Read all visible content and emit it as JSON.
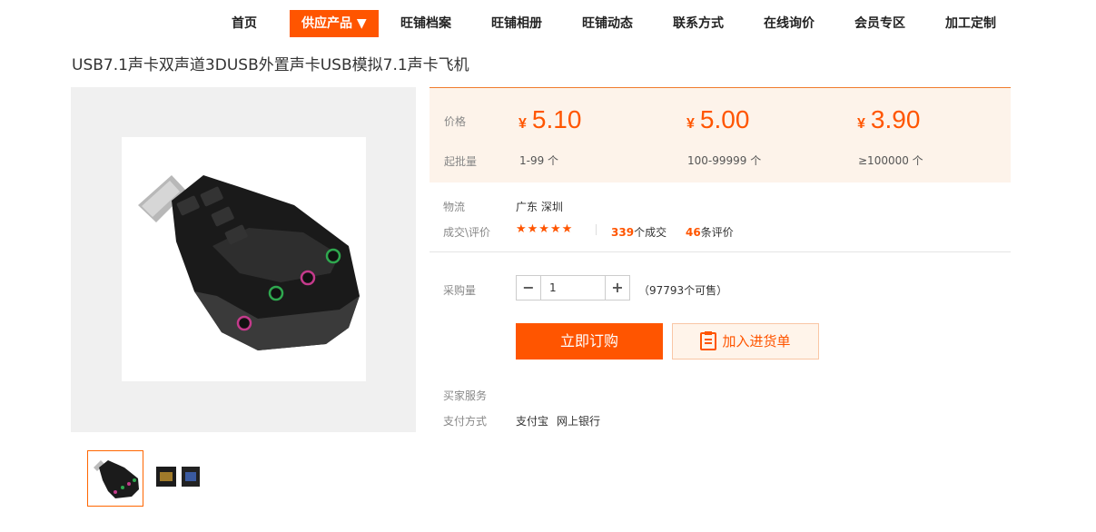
{
  "nav": {
    "items": [
      "首页",
      "供应产品 ▼",
      "旺铺档案",
      "旺铺相册",
      "旺铺动态",
      "联系方式",
      "在线询价",
      "会员专区",
      "加工定制"
    ]
  },
  "product": {
    "title": "USB7.1声卡双声道3DUSB外置声卡USB模拟7.1声卡飞机"
  },
  "price": {
    "price_label": "价格",
    "moq_label": "起批量",
    "currency": "¥",
    "tiers": [
      {
        "price": "5.10",
        "qty": "1-99 个"
      },
      {
        "price": "5.00",
        "qty": "100-99999 个"
      },
      {
        "price": "3.90",
        "qty": "≥100000 个"
      }
    ]
  },
  "logistics": {
    "label": "物流",
    "value": "广东 深圳"
  },
  "deals": {
    "label": "成交\\评价",
    "stars": "★★★★★",
    "deal_count": "339",
    "deal_unit": "个成交",
    "review_count": "46",
    "review_unit": "条评价"
  },
  "purchase": {
    "label": "采购量",
    "minus": "−",
    "plus": "+",
    "value": "1",
    "available": "（97793个可售）"
  },
  "buttons": {
    "buy": "立即订购",
    "cart": "加入进货单"
  },
  "service": {
    "label": "买家服务"
  },
  "payment": {
    "label": "支付方式",
    "methods": [
      "支付宝",
      "网上银行"
    ]
  },
  "colors": {
    "accent": "#ff5500",
    "price_bg": "#fdf3ea"
  }
}
